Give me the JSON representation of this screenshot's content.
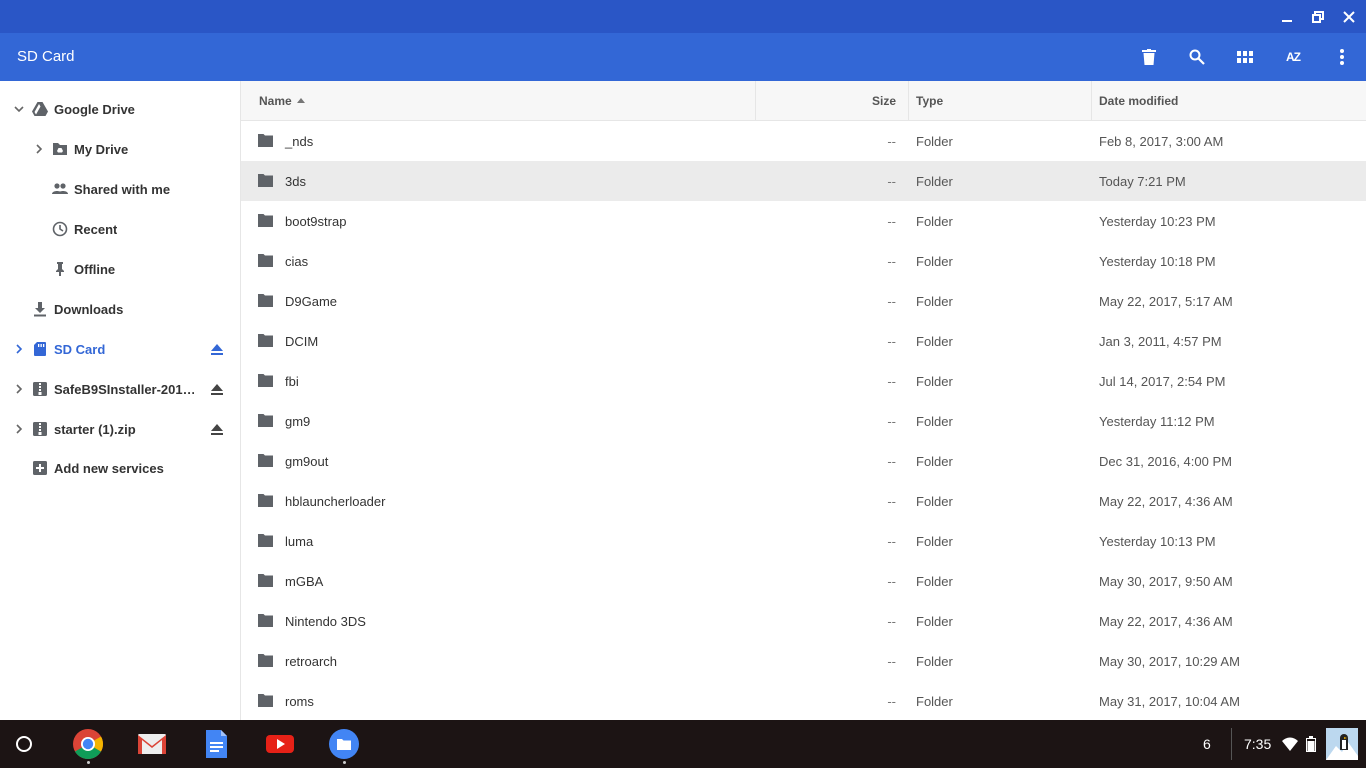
{
  "window": {
    "title": "SD Card",
    "controls": [
      "minimize-icon",
      "maximize-icon",
      "close-icon"
    ]
  },
  "header": {
    "title": "SD Card",
    "actions": [
      "delete-icon",
      "search-icon",
      "grid-view-icon",
      "sort-az-icon",
      "more-vert-icon"
    ],
    "sort_label": "AZ"
  },
  "sidebar": {
    "items": [
      {
        "label": "Google Drive",
        "icon": "google-drive-icon",
        "expanded": true
      },
      {
        "label": "My Drive",
        "icon": "my-drive-icon"
      },
      {
        "label": "Shared with me",
        "icon": "people-icon"
      },
      {
        "label": "Recent",
        "icon": "clock-icon"
      },
      {
        "label": "Offline",
        "icon": "pin-icon"
      },
      {
        "label": "Downloads",
        "icon": "download-icon"
      },
      {
        "label": "SD Card",
        "icon": "sd-card-icon",
        "active": true
      },
      {
        "label": "SafeB9SInstaller-201…",
        "icon": "zip-icon"
      },
      {
        "label": "starter (1).zip",
        "icon": "zip-icon"
      },
      {
        "label": "Add new services",
        "icon": "add-box-icon"
      }
    ]
  },
  "columns": {
    "name": "Name",
    "size": "Size",
    "type": "Type",
    "date": "Date modified"
  },
  "files": [
    {
      "name": "_nds",
      "size": "--",
      "type": "Folder",
      "date": "Feb 8, 2017, 3:00 AM"
    },
    {
      "name": "3ds",
      "size": "--",
      "type": "Folder",
      "date": "Today 7:21 PM",
      "selected": true
    },
    {
      "name": "boot9strap",
      "size": "--",
      "type": "Folder",
      "date": "Yesterday 10:23 PM"
    },
    {
      "name": "cias",
      "size": "--",
      "type": "Folder",
      "date": "Yesterday 10:18 PM"
    },
    {
      "name": "D9Game",
      "size": "--",
      "type": "Folder",
      "date": "May 22, 2017, 5:17 AM"
    },
    {
      "name": "DCIM",
      "size": "--",
      "type": "Folder",
      "date": "Jan 3, 2011, 4:57 PM"
    },
    {
      "name": "fbi",
      "size": "--",
      "type": "Folder",
      "date": "Jul 14, 2017, 2:54 PM"
    },
    {
      "name": "gm9",
      "size": "--",
      "type": "Folder",
      "date": "Yesterday 11:12 PM"
    },
    {
      "name": "gm9out",
      "size": "--",
      "type": "Folder",
      "date": "Dec 31, 2016, 4:00 PM"
    },
    {
      "name": "hblauncherloader",
      "size": "--",
      "type": "Folder",
      "date": "May 22, 2017, 4:36 AM"
    },
    {
      "name": "luma",
      "size": "--",
      "type": "Folder",
      "date": "Yesterday 10:13 PM"
    },
    {
      "name": "mGBA",
      "size": "--",
      "type": "Folder",
      "date": "May 30, 2017, 9:50 AM"
    },
    {
      "name": "Nintendo 3DS",
      "size": "--",
      "type": "Folder",
      "date": "May 22, 2017, 4:36 AM"
    },
    {
      "name": "retroarch",
      "size": "--",
      "type": "Folder",
      "date": "May 30, 2017, 10:29 AM"
    },
    {
      "name": "roms",
      "size": "--",
      "type": "Folder",
      "date": "May 31, 2017, 10:04 AM"
    }
  ],
  "shelf": {
    "apps": [
      "chrome-icon",
      "gmail-icon",
      "docs-icon",
      "youtube-icon",
      "files-icon"
    ],
    "notification_count": "6",
    "time": "7:35"
  },
  "colors": {
    "titlebar": "#2a56c6",
    "header": "#3367d6",
    "active": "#3367d6",
    "shelf": "#1c1414"
  }
}
